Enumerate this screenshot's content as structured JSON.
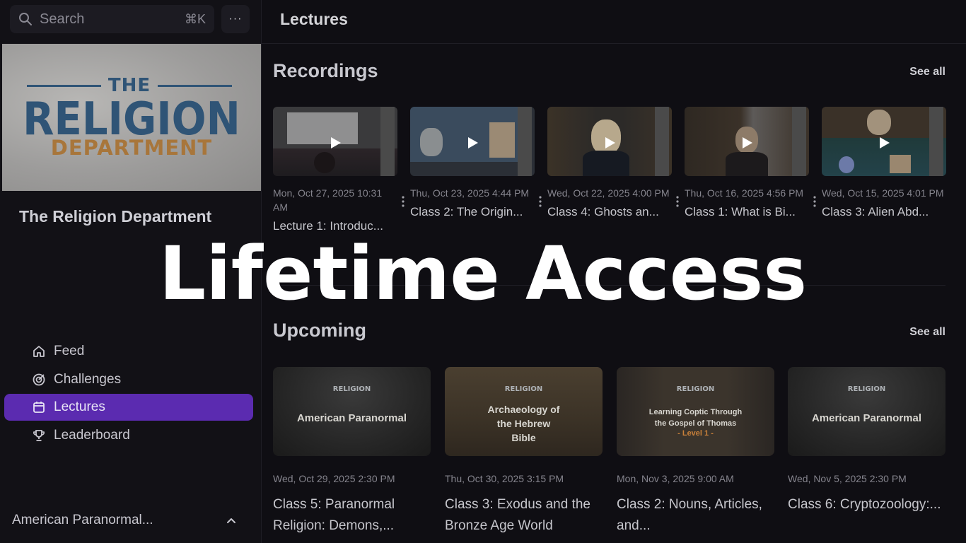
{
  "search": {
    "placeholder": "Search",
    "shortcut": "⌘K"
  },
  "more_button": "···",
  "logo": {
    "top": "THE",
    "main": "RELIGION",
    "bottom": "DEPARTMENT"
  },
  "community_name": "The Religion Department",
  "nav": [
    {
      "label": "Feed",
      "icon": "home-icon",
      "active": false
    },
    {
      "label": "Challenges",
      "icon": "target-icon",
      "active": false
    },
    {
      "label": "Lectures",
      "icon": "calendar-icon",
      "active": true
    },
    {
      "label": "Leaderboard",
      "icon": "trophy-icon",
      "active": false
    }
  ],
  "sidebar_section": {
    "title": "American Paranormal..."
  },
  "page_title": "Lectures",
  "recordings": {
    "heading": "Recordings",
    "see_all": "See all",
    "items": [
      {
        "date": "Mon, Oct 27, 2025 10:31 AM",
        "title": "Lecture 1: Introduc..."
      },
      {
        "date": "Thu, Oct 23, 2025 4:44 PM",
        "title": "Class 2: The Origin..."
      },
      {
        "date": "Wed, Oct 22, 2025 4:00 PM",
        "title": "Class 4: Ghosts an..."
      },
      {
        "date": "Thu, Oct 16, 2025 4:56 PM",
        "title": "Class 1: What is Bi..."
      },
      {
        "date": "Wed, Oct 15, 2025 4:01 PM",
        "title": "Class 3: Alien Abd..."
      }
    ]
  },
  "upcoming": {
    "heading": "Upcoming",
    "see_all": "See all",
    "items": [
      {
        "thumb_logo": "RELIGION",
        "thumb_title": "American Paranormal",
        "thumb_sub": "",
        "date": "Wed, Oct 29, 2025 2:30 PM",
        "title": "Class 5: Paranormal Religion: Demons,..."
      },
      {
        "thumb_logo": "RELIGION",
        "thumb_title": "Archaeology of the Hebrew Bible",
        "thumb_sub": "",
        "date": "Thu, Oct 30, 2025 3:15 PM",
        "title": "Class 3: Exodus and the Bronze Age World"
      },
      {
        "thumb_logo": "RELIGION",
        "thumb_title": "Learning Coptic Through the Gospel of Thomas",
        "thumb_sub": "- Level 1 -",
        "date": "Mon, Nov 3, 2025 9:00 AM",
        "title": "Class 2: Nouns, Articles, and..."
      },
      {
        "thumb_logo": "RELIGION",
        "thumb_title": "American Paranormal",
        "thumb_sub": "",
        "date": "Wed, Nov 5, 2025 2:30 PM",
        "title": "Class 6: Cryptozoology:..."
      }
    ]
  },
  "overlay_text": "Lifetime Access",
  "colors": {
    "accent": "#5b2bb0",
    "background": "#0f0e13",
    "sidebar": "#121116"
  }
}
